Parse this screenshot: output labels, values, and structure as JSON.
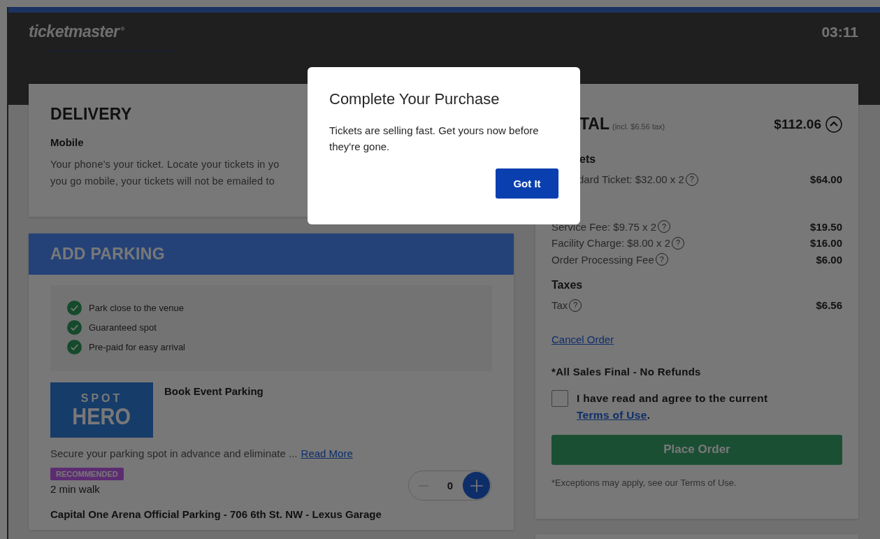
{
  "header": {
    "logo": "ticketmaster",
    "logo_mark": "®",
    "timer": "03:11"
  },
  "delivery": {
    "title": "DELIVERY",
    "method": "Mobile",
    "lines": [
      "Your phone's your ticket. Locate your tickets in yo",
      "you go mobile, your tickets will not be emailed to"
    ]
  },
  "parking": {
    "title": "ADD PARKING",
    "benefits": [
      "Park close to the venue",
      "Guaranteed spot",
      "Pre-paid for easy arrival"
    ],
    "provider_logo": {
      "top": "SPOT",
      "bottom": "HERO"
    },
    "offer_title": "Book Event Parking",
    "description": "Secure your parking spot in advance and eliminate ...",
    "read_more": "Read More",
    "badge": "RECOMMENDED",
    "walk": "2 min walk",
    "quantity": "0",
    "location": "Capital One Arena Official Parking - 706 6th St. NW - Lexus Garage"
  },
  "total": {
    "title": "TAL",
    "tax_note": "(incl. $6.56 tax)",
    "amount": "$112.06",
    "expanded": true,
    "help_mark": "?",
    "sections": [
      {
        "heading": "ets",
        "lines": [
          {
            "label": "dard Ticket: $32.00 x 2",
            "amount": "$64.00"
          }
        ]
      },
      {
        "lines": [
          {
            "label": "Service Fee: $9.75 x 2",
            "amount": "$19.50"
          },
          {
            "label": "Facility Charge: $8.00 x 2",
            "amount": "$16.00"
          },
          {
            "label": "Order Processing Fee",
            "amount": "$6.00"
          }
        ]
      },
      {
        "heading": "Taxes",
        "lines": [
          {
            "label": "Tax",
            "amount": "$6.56"
          }
        ]
      }
    ],
    "cancel": "Cancel Order",
    "final_note": "*All Sales Final - No Refunds",
    "agree": {
      "checked": false,
      "text": "I have read and agree to the current ",
      "link": "Terms of Use",
      "after": "."
    },
    "place_order": "Place Order",
    "exceptions": "*Exceptions may apply, see our Terms of Use."
  },
  "modal": {
    "title": "Complete Your Purchase",
    "message": "Tickets are selling fast. Get yours now before they're gone.",
    "button": "Got It"
  }
}
